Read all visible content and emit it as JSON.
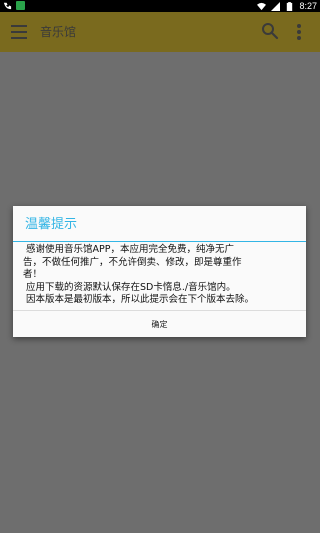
{
  "status_bar": {
    "time": "8:27",
    "left_icons": [
      "phone-icon",
      "notification-icon"
    ],
    "right_icons": [
      "wifi-icon",
      "signal-icon",
      "battery-icon"
    ]
  },
  "app_bar": {
    "title": "音乐馆",
    "menu_icon": "hamburger-menu-icon",
    "search_icon": "search-icon",
    "overflow_icon": "more-vert-icon",
    "color": "#7a6a1e"
  },
  "dialog": {
    "title": "温馨提示",
    "title_color": "#33b5e5",
    "message": " 感谢使用音乐馆APP，本应用完全免费，纯净无广\n告，不做任何推广，不允许倒卖、修改，即是尊重作\n者！\n 应用下载的资源默认保存在SD卡惰息./音乐馆内。\n 因本版本是最初版本，所以此提示会在下个版本去除。",
    "button_label": "确定"
  }
}
